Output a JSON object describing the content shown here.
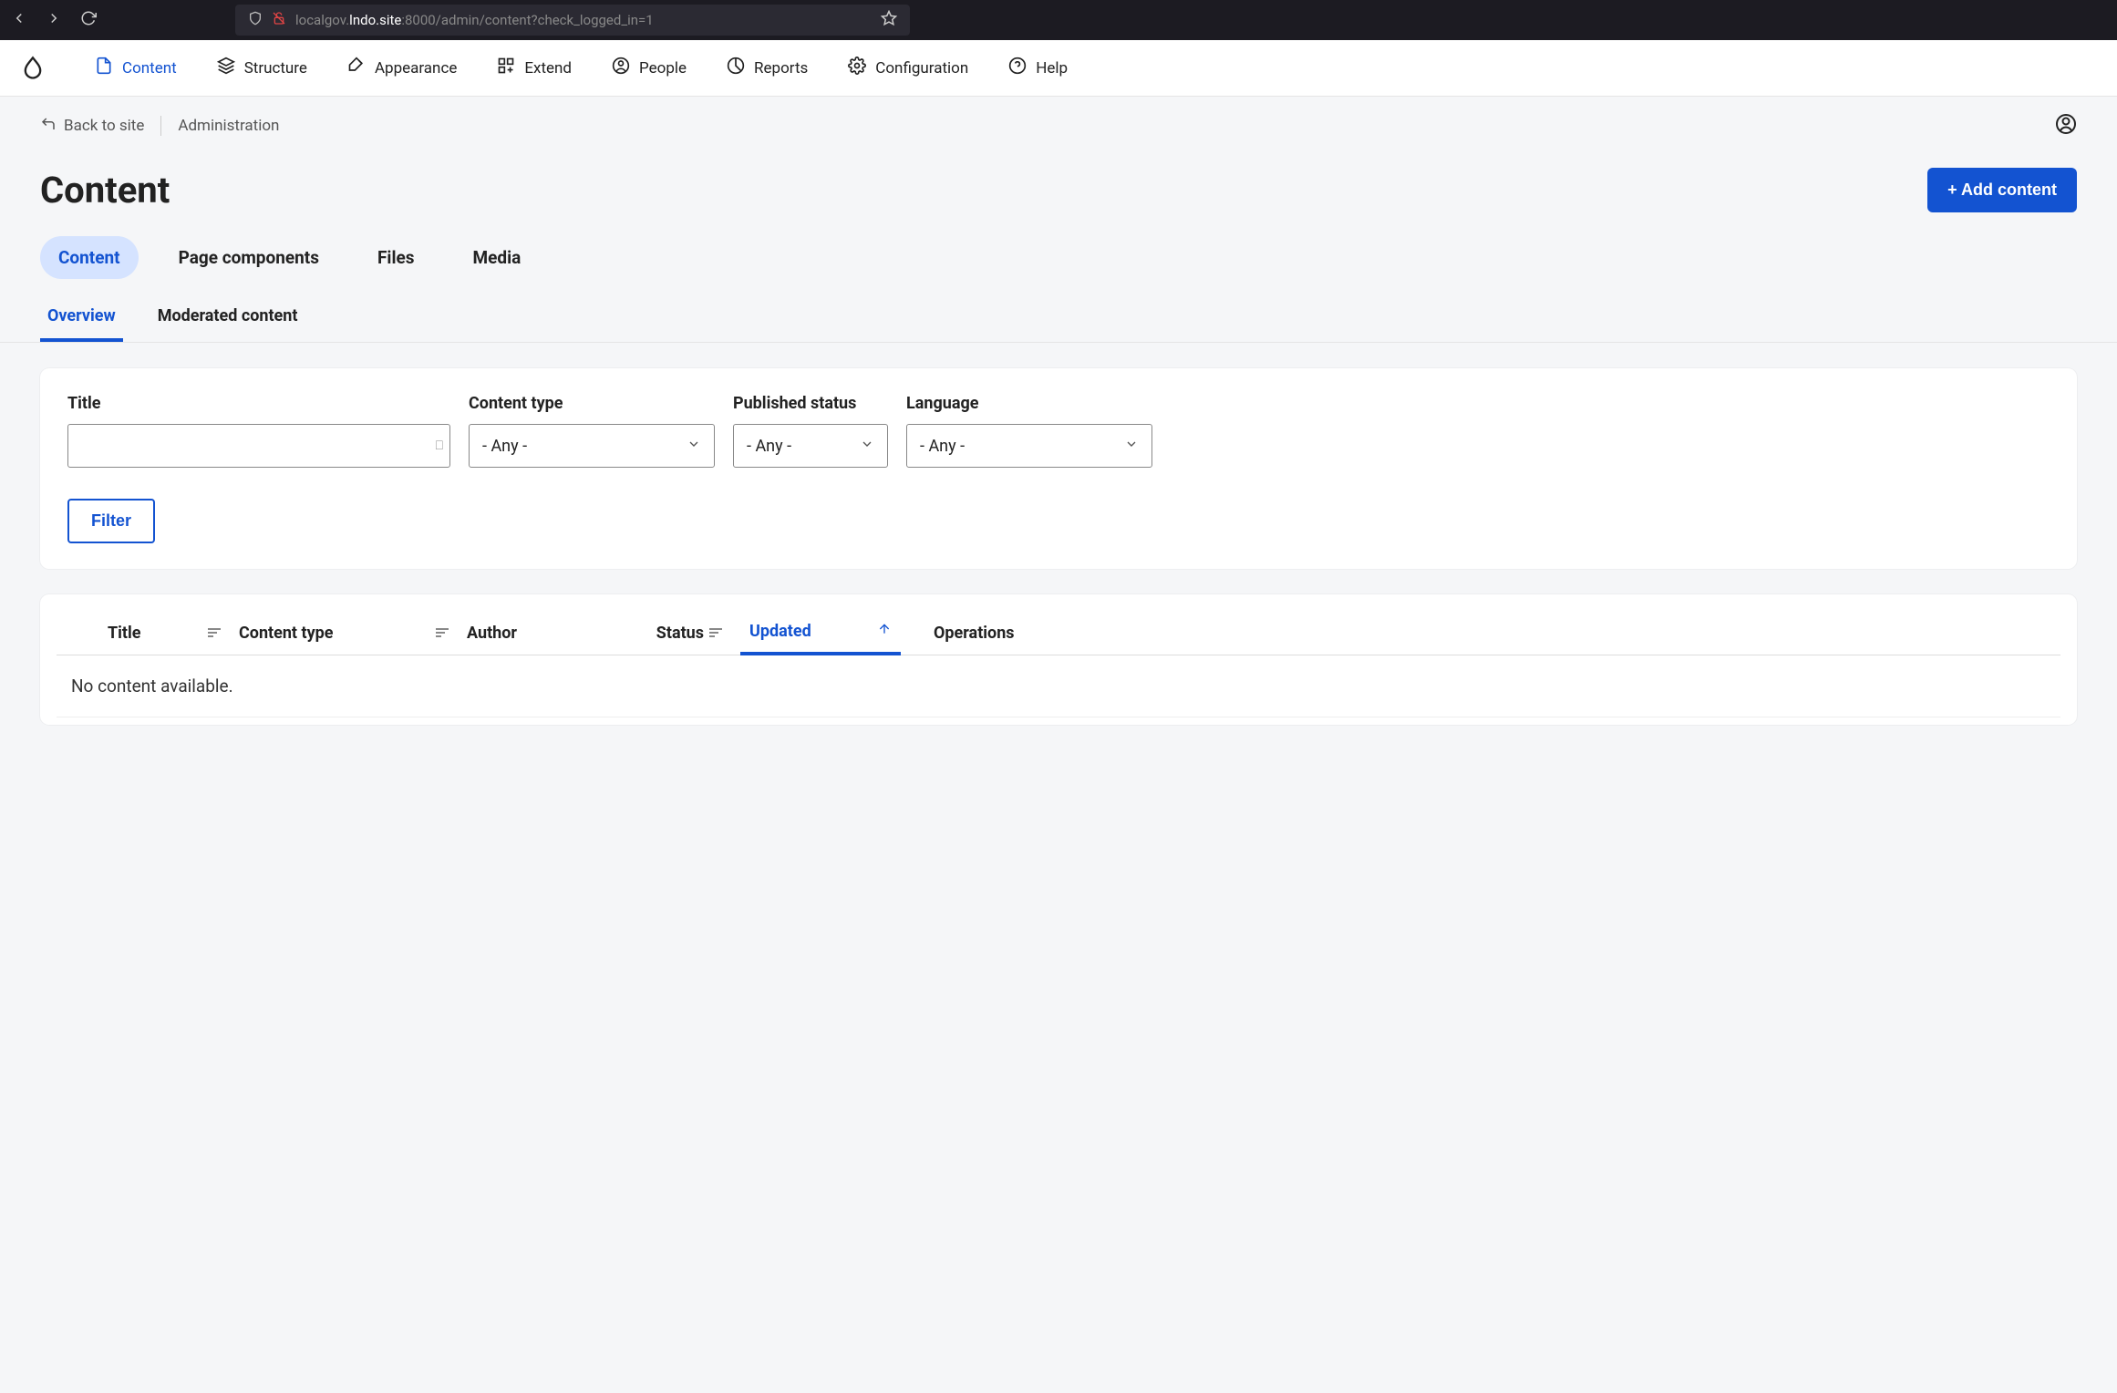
{
  "browser": {
    "url_prefix": "localgov.",
    "url_bold": "lndo.site",
    "url_rest": ":8000/admin/content?check_logged_in=1"
  },
  "admin_nav": {
    "items": [
      {
        "label": "Content"
      },
      {
        "label": "Structure"
      },
      {
        "label": "Appearance"
      },
      {
        "label": "Extend"
      },
      {
        "label": "People"
      },
      {
        "label": "Reports"
      },
      {
        "label": "Configuration"
      },
      {
        "label": "Help"
      }
    ]
  },
  "breadcrumb": {
    "back": "Back to site",
    "admin": "Administration"
  },
  "page": {
    "title": "Content",
    "add_button": "+ Add content"
  },
  "primary_tabs": [
    {
      "label": "Content"
    },
    {
      "label": "Page components"
    },
    {
      "label": "Files"
    },
    {
      "label": "Media"
    }
  ],
  "secondary_tabs": [
    {
      "label": "Overview"
    },
    {
      "label": "Moderated content"
    }
  ],
  "filters": {
    "title_label": "Title",
    "title_value": "",
    "type_label": "Content type",
    "type_value": "- Any -",
    "status_label": "Published status",
    "status_value": "- Any -",
    "language_label": "Language",
    "language_value": "- Any -",
    "filter_button": "Filter"
  },
  "table": {
    "columns": {
      "title": "Title",
      "type": "Content type",
      "author": "Author",
      "status": "Status",
      "updated": "Updated",
      "operations": "Operations"
    },
    "empty": "No content available."
  }
}
